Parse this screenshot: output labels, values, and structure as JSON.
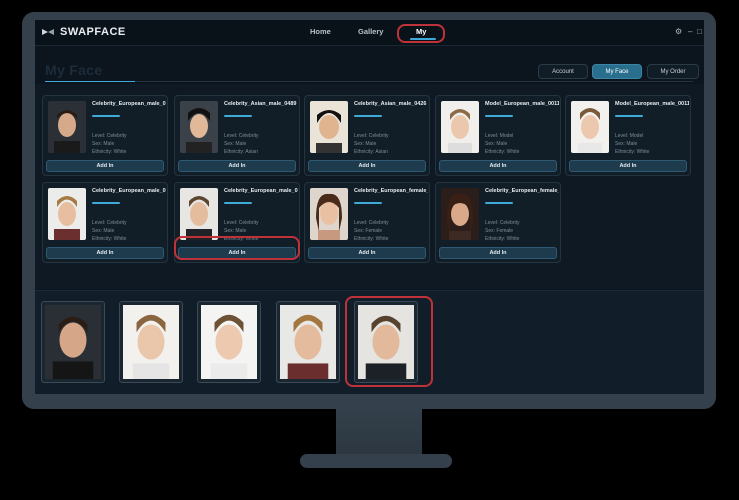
{
  "app": {
    "name": "SWAPFACE"
  },
  "nav": {
    "home": "Home",
    "gallery": "Gallery",
    "my": "My"
  },
  "window_controls": {
    "settings": "⚙",
    "minimize": "–",
    "maximize": "□"
  },
  "page": {
    "title": "My Face"
  },
  "tabs": {
    "account": "Account",
    "my_face": "My Face",
    "my_order": "My Order",
    "active": "My Face"
  },
  "cards": [
    {
      "name": "Celebrity_European_male_0 26",
      "level": "Level: Celebrity",
      "sex": "Sex: Male",
      "ethnicity": "Ethnicity: White",
      "button": "Add In"
    },
    {
      "name": "Celebrity_Asian_male_0489",
      "level": "Level: Celebrity",
      "sex": "Sex: Male",
      "ethnicity": "Ethnicity: Asian",
      "button": "Add In"
    },
    {
      "name": "Celebrity_Asian_male_0426",
      "level": "Level: Celebrity",
      "sex": "Sex: Male",
      "ethnicity": "Ethnicity: Asian",
      "button": "Add In"
    },
    {
      "name": "Model_European_male_0011",
      "level": "Level: Model",
      "sex": "Sex: Male",
      "ethnicity": "Ethnicity: White",
      "button": "Add In"
    },
    {
      "name": "Model_European_male_0011",
      "level": "Level: Model",
      "sex": "Sex: Male",
      "ethnicity": "Ethnicity: White",
      "button": "Add In"
    },
    {
      "name": "Celebrity_European_male_0 30",
      "level": "Level: Celebrity",
      "sex": "Sex: Male",
      "ethnicity": "Ethnicity: White",
      "button": "Add In"
    },
    {
      "name": "Celebrity_European_male_0 24a",
      "level": "Level: Celebrity",
      "sex": "Sex: Male",
      "ethnicity": "Ethnicity: White",
      "button": "Add In"
    },
    {
      "name": "Celebrity_European_female_ 0310",
      "level": "Level: Celebrity",
      "sex": "Sex: Female",
      "ethnicity": "Ethnicity: White",
      "button": "Add In"
    },
    {
      "name": "Celebrity_European_female_ 0326",
      "level": "Level: Celebrity",
      "sex": "Sex: Female",
      "ethnicity": "Ethnicity: White",
      "button": "Add In"
    }
  ],
  "colors": {
    "accent": "#3fa9d8",
    "highlight": "#c0323a",
    "bg": "#0c151e"
  },
  "icons": {
    "logo": "swapface-logo-icon"
  }
}
